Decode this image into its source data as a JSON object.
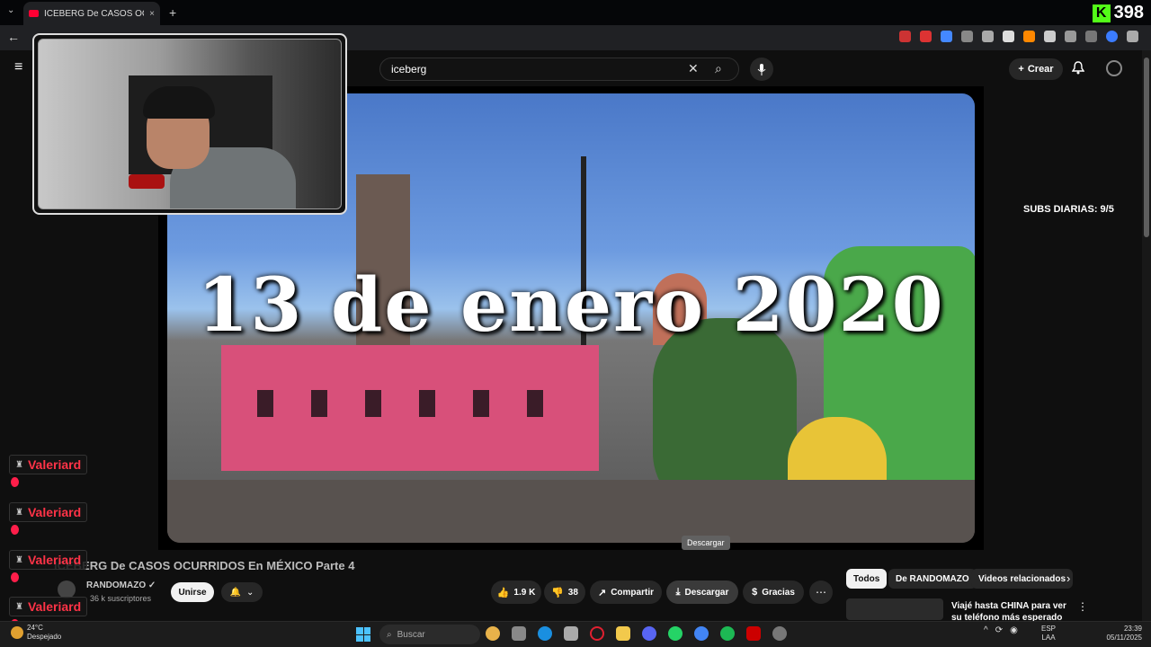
{
  "browser": {
    "tab_title": "ICEBERG De CASOS OCURRIDOS",
    "tab_close": "×",
    "new_tab": "+",
    "tab_menu": "⌄",
    "back": "←",
    "kick_logo": "K",
    "kick_count": "398"
  },
  "youtube": {
    "search_query": "iceberg",
    "clear_icon": "✕",
    "search_icon": "⌕",
    "mic_icon": "🎙",
    "create_label": "Crear",
    "create_icon": "+",
    "bell_icon": "🔔"
  },
  "video": {
    "overlay_text": "13 de enero 2020",
    "subs_daily": "SUBS DIARIAS: 9/5",
    "tooltip": "Descargar",
    "title": "ICEBERG De CASOS OCURRIDOS En MÉXICO Parte 4"
  },
  "channel": {
    "name": "RANDOMAZO ✓",
    "subscribers": "36 k suscriptores",
    "join_label": "Unirse",
    "bell_icon": "🔔",
    "chevron": "⌄"
  },
  "actions": {
    "likes": "1.9 K",
    "dislikes": "38",
    "share": "Compartir",
    "download": "Descargar",
    "thanks": "Gracias",
    "more": "⋯",
    "like_icon": "👍",
    "dislike_icon": "👎",
    "share_icon": "↗",
    "download_icon": "⤓",
    "thanks_icon": "$"
  },
  "chips": {
    "all": "Todos",
    "channel": "De RANDOMAZO",
    "related": "Videos relacionados",
    "next": "›"
  },
  "recommendation": {
    "title": "Viajé hasta CHINA para ver su teléfono más esperado del añ",
    "menu": "⋮"
  },
  "chat": {
    "names": [
      "Valeriard",
      "Valeriard",
      "Valeriard",
      "Valeriard"
    ],
    "icon": "♜"
  },
  "taskbar": {
    "temp": "24°C",
    "weather": "Despejado",
    "search_placeholder": "Buscar",
    "search_icon": "⌕",
    "lang1": "ESP",
    "lang2": "LAA",
    "time": "23:39",
    "date": "05/11/2025",
    "tray_up": "^"
  }
}
